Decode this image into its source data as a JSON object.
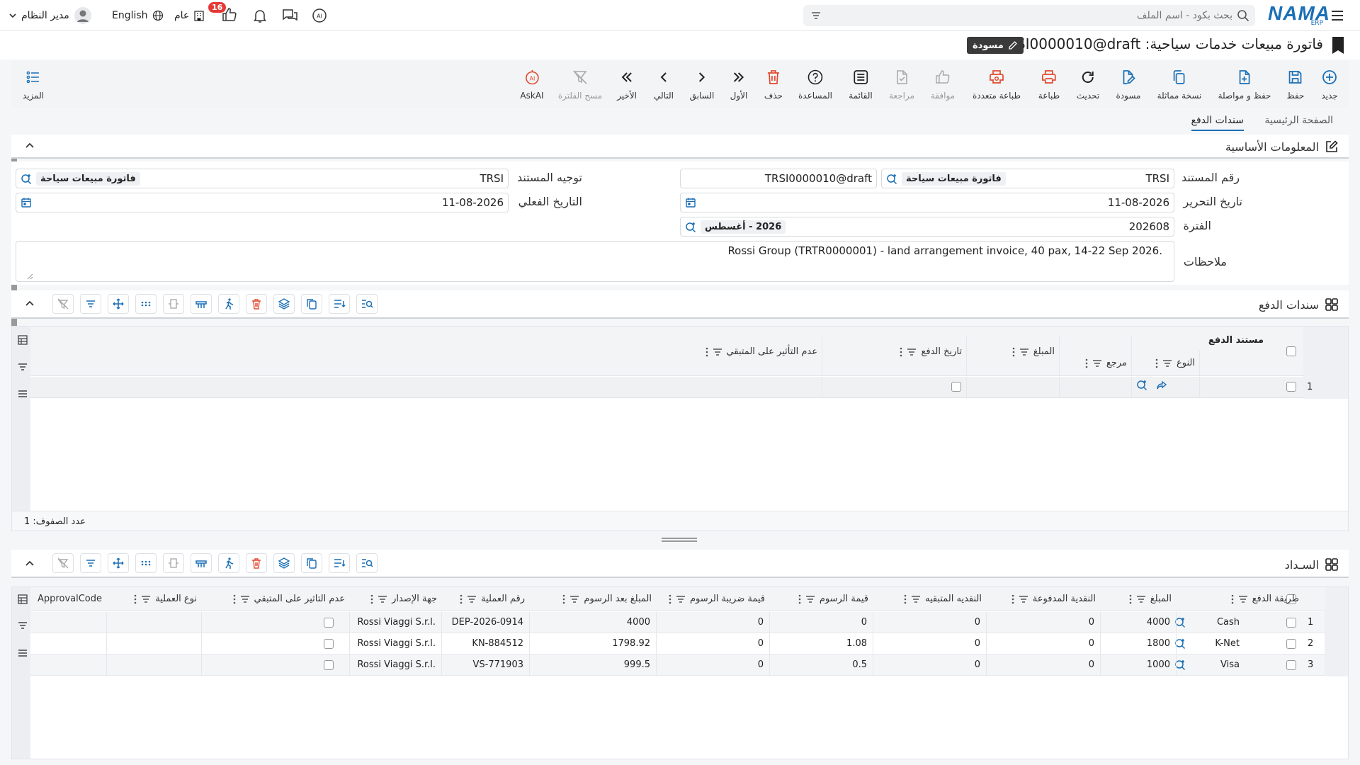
{
  "topbar": {
    "search_placeholder": "بحث بكود - اسم الملف",
    "logo_text": "NAMA",
    "logo_sub": "ERP",
    "user_name": "مدير النظام",
    "language": "English",
    "branch": "عام",
    "notification_count": "16"
  },
  "title": {
    "text": "فاتورة مبيعات خدمات سياحية: TRSI0000010@draft",
    "status_badge": "مسودة"
  },
  "toolbar": {
    "new": "جديد",
    "save": "حفظ",
    "save_continue": "حفظ و مواصلة",
    "duplicate": "نسخة مماثلة",
    "draft": "مسودة",
    "refresh": "تحديث",
    "print": "طباعة",
    "multi_print": "طباعة متعددة",
    "approve": "موافقة",
    "review": "مراجعة",
    "list": "القائمة",
    "help": "المساعدة",
    "delete": "حذف",
    "first": "الأول",
    "previous": "السابق",
    "next": "التالي",
    "last": "الأخير",
    "clear_filter": "مسح الفلترة",
    "askai": "AskAI",
    "more": "المزيد"
  },
  "tabs": {
    "main": "الصفحة الرئيسية",
    "payment_docs": "سندات الدفع"
  },
  "basic_info": {
    "section_title": "المعلومات الأساسية",
    "doc_number_label": "رقم المستند",
    "doc_number_code": "TRSI",
    "doc_number_type": "فاتورة مبيعات سياحة",
    "doc_number_value": "TRSI0000010@draft",
    "doc_direction_label": "توجيه المستند",
    "doc_direction_code": "TRSI",
    "doc_direction_type": "فاتورة مبيعات سياحة",
    "issue_date_label": "تاريخ التحرير",
    "issue_date": "11-08-2026",
    "actual_date_label": "التاريخ الفعلي",
    "actual_date": "11-08-2026",
    "period_label": "الفترة",
    "period_code": "202608",
    "period_name": "2026 - أغسطس",
    "notes_label": "ملاحظات",
    "notes": "Rossi Group (TRTR0000001) - land arrangement invoice, 40 pax, 14-22 Sep 2026."
  },
  "payment_docs_grid": {
    "section_title": "سندات الدفع",
    "group_header": "مستند الدفع",
    "columns": [
      "النوع",
      "مرجع",
      "المبلغ",
      "تاريخ الدفع",
      "عدم التأثير على المتبقي"
    ],
    "rows": [
      {
        "num": "1"
      }
    ],
    "row_count_label": "عدد الصفوف: 1"
  },
  "settlement_grid": {
    "section_title": "السـداد",
    "columns": [
      "طريقة الدفع",
      "المبلغ",
      "النقدية المدفوعة",
      "النقديه المتبقيه",
      "قيمة الرسوم",
      "قيمة ضريبة الرسوم",
      "المبلغ بعد الرسوم",
      "رقم العملية",
      "جهة الإصدار",
      "عدم التأثير على المتبقي",
      "نوع العملية",
      "ApprovalCode"
    ],
    "rows": [
      {
        "num": "1",
        "method": "Cash",
        "amount": "4000",
        "paid": "0",
        "remaining": "0",
        "fee": "0",
        "fee_tax": "0",
        "net": "4000",
        "op_no": "DEP-2026-0914",
        "issuer": "Rossi Viaggi S.r.l."
      },
      {
        "num": "2",
        "method": "K-Net",
        "amount": "1800",
        "paid": "0",
        "remaining": "0",
        "fee": "1.08",
        "fee_tax": "0",
        "net": "1798.92",
        "op_no": "KN-884512",
        "issuer": "Rossi Viaggi S.r.l."
      },
      {
        "num": "3",
        "method": "Visa",
        "amount": "1000",
        "paid": "0",
        "remaining": "0",
        "fee": "0.5",
        "fee_tax": "0",
        "net": "999.5",
        "op_no": "VS-771903",
        "issuer": "Rossi Viaggi S.r.l."
      }
    ]
  },
  "colors": {
    "accent": "#1a6fb5",
    "danger": "#e04a2f",
    "teal": "#1d7f8c",
    "badge": "#333333"
  }
}
